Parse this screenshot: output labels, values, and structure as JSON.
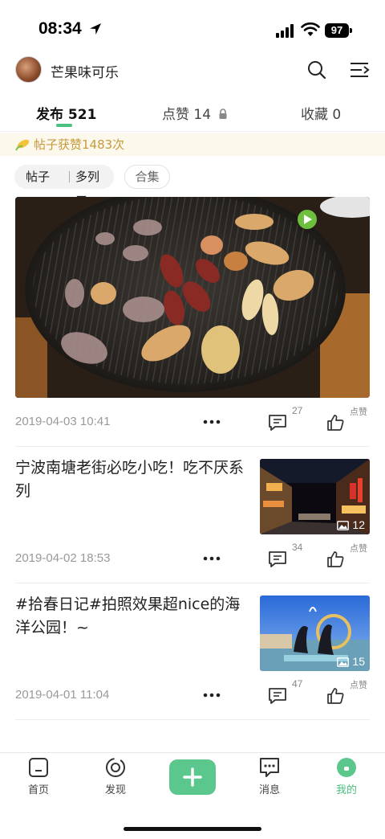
{
  "status_bar": {
    "time": "08:34",
    "battery": "97"
  },
  "profile": {
    "username": "芒果味可乐"
  },
  "tabs": [
    {
      "label": "发布",
      "count": "521"
    },
    {
      "label": "点赞",
      "count": "14"
    },
    {
      "label": "收藏",
      "count": "0"
    }
  ],
  "likes_banner": {
    "text": "帖子获赞1483次"
  },
  "filters": {
    "type_label": "帖子",
    "series_label": "多列 三",
    "collection_label": "合集"
  },
  "posts": [
    {
      "date": "2019-04-03 10:41",
      "comments": "27",
      "like_label": "点赞"
    },
    {
      "title": "宁波南塘老街必吃小吃！吃不厌系列",
      "image_count": "12",
      "date": "2019-04-02 18:53",
      "comments": "34",
      "like_label": "点赞"
    },
    {
      "title": "#拾春日记#拍照效果超nice的海洋公园！~",
      "image_count": "15",
      "date": "2019-04-01 11:04",
      "comments": "47",
      "like_label": "点赞"
    }
  ],
  "bottom_nav": [
    {
      "label": "首页"
    },
    {
      "label": "发现"
    },
    {
      "label": "消息"
    },
    {
      "label": "我的"
    }
  ],
  "colors": {
    "accent": "#4cc07e",
    "banner_text": "#c69a3c",
    "banner_bg": "#fdf8ec"
  }
}
